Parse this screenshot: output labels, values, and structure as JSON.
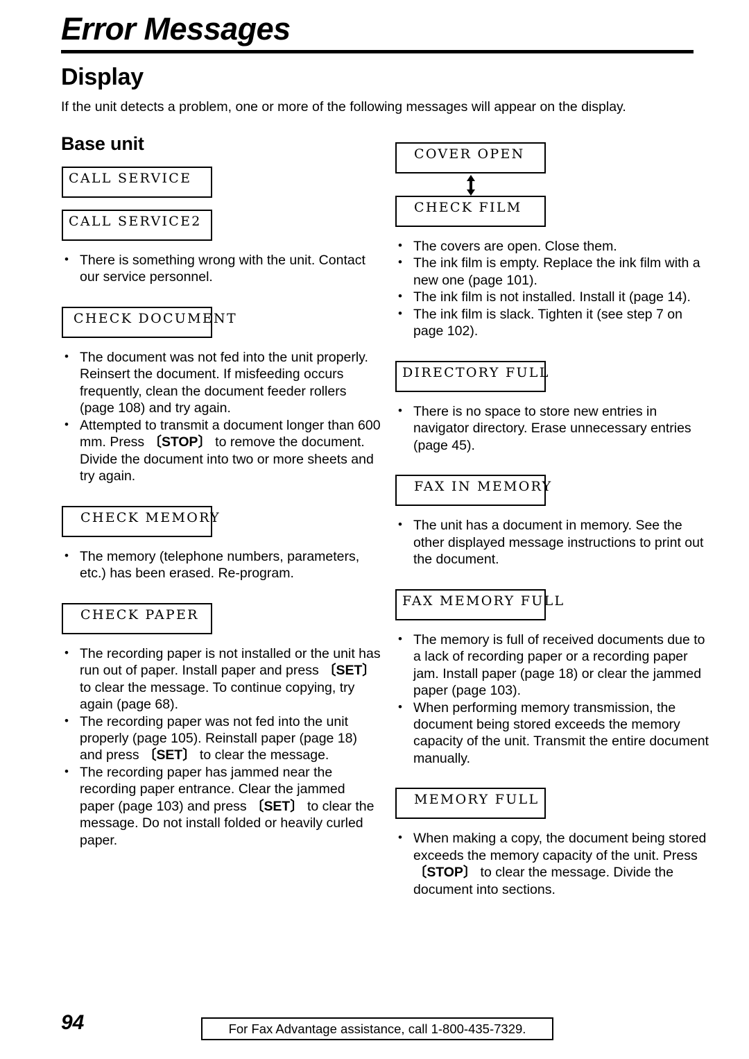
{
  "header": {
    "chapter_title": "Error Messages",
    "section_title": "Display",
    "intro": "If the unit detects a problem, one or more of the following messages will appear on the display.",
    "subsection_title": "Base unit"
  },
  "icons": {
    "up_down_arrow": "up-down-arrow-icon"
  },
  "left_column": {
    "groups": [
      {
        "displays": [
          "CALL SERVICE",
          "CALL SERVICE2"
        ],
        "bullets": [
          "There is something wrong with the unit. Contact our service personnel."
        ]
      },
      {
        "displays": [
          "CHECK DOCUMENT"
        ],
        "bullets": [
          "The document was not fed into the unit properly. Reinsert the document. If misfeeding occurs frequently, clean the document feeder rollers (page 108) and try again.",
          "Attempted to transmit a document longer than 600 mm. Press [STOP] to remove the document. Divide the document into two or more sheets and try again."
        ]
      },
      {
        "displays": [
          "CHECK MEMORY"
        ],
        "bullets": [
          "The memory (telephone numbers, parameters, etc.) has been erased. Re-program."
        ]
      },
      {
        "displays": [
          "CHECK PAPER"
        ],
        "bullets": [
          "The recording paper is not installed or the unit has run out of paper. Install paper and press [SET] to clear the message. To continue copying, try again (page 68).",
          "The recording paper was not fed into the unit properly (page 105). Reinstall paper (page 18) and press [SET] to clear the message.",
          "The recording paper has jammed near the recording paper entrance. Clear the jammed paper (page 103) and press [SET] to clear the message. Do not install folded or heavily curled paper."
        ]
      }
    ]
  },
  "right_column": {
    "groups": [
      {
        "displays": [
          "COVER OPEN",
          "CHECK FILM"
        ],
        "arrow_between": true,
        "bullets": [
          "The covers are open. Close them.",
          "The ink film is empty. Replace the ink film with a new one (page 101).",
          "The ink film is not installed. Install it (page 14).",
          "The ink film is slack. Tighten it (see step 7 on page 102)."
        ]
      },
      {
        "displays": [
          "DIRECTORY FULL"
        ],
        "bullets": [
          "There is no space to store new entries in navigator directory. Erase unnecessary entries (page 45)."
        ]
      },
      {
        "displays": [
          "FAX IN MEMORY"
        ],
        "bullets": [
          "The unit has a document in memory. See the other displayed message instructions to print out the document."
        ]
      },
      {
        "displays": [
          "FAX MEMORY FULL"
        ],
        "bullets": [
          "The memory is full of received documents due to a lack of recording paper or a recording paper jam. Install paper (page 18) or clear the jammed paper (page 103).",
          "When performing memory transmission, the document being stored exceeds the memory capacity of the unit. Transmit the entire document manually."
        ]
      },
      {
        "displays": [
          "MEMORY FULL"
        ],
        "bullets": [
          "When making a copy, the document being stored exceeds the memory capacity of the unit. Press [STOP] to clear the message. Divide the document into sections."
        ]
      }
    ]
  },
  "footer": {
    "page_number": "94",
    "notice": "For Fax Advantage assistance, call 1-800-435-7329."
  }
}
